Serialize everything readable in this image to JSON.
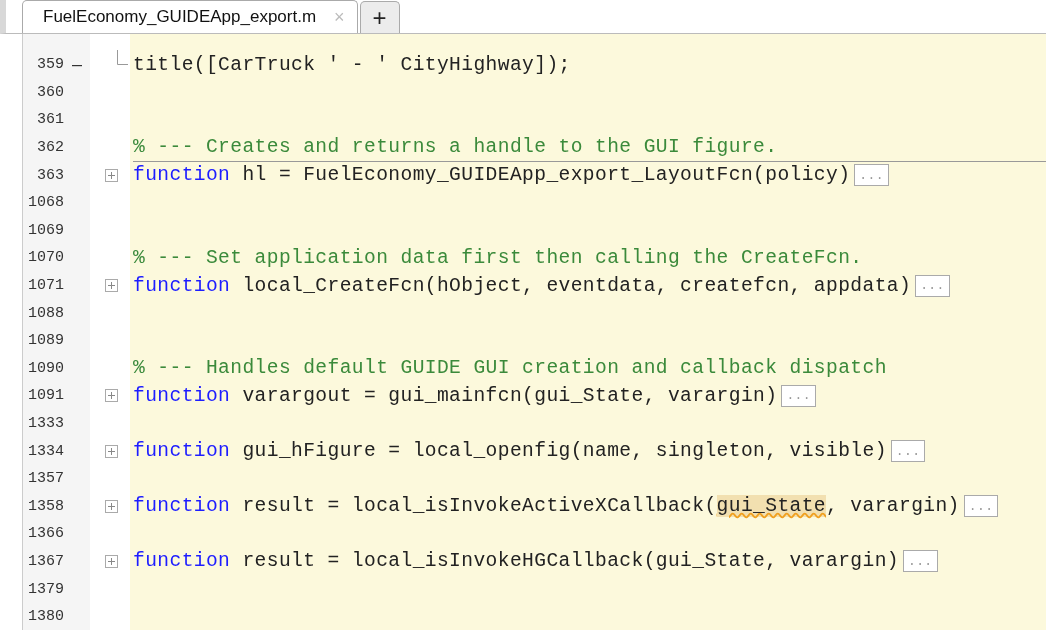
{
  "tabs": [
    {
      "label": "FuelEconomy_GUIDEApp_export.m",
      "selected": true,
      "close": "×"
    }
  ],
  "new_tab": "+",
  "lines": [
    {
      "number": "359",
      "kind": "code",
      "breakpoint_dash": "–",
      "fold_end": true,
      "segments": [
        {
          "text": "title([CarTruck ' - ' CityHighway]);",
          "kind": "plain"
        }
      ]
    },
    {
      "number": "360",
      "kind": "blank"
    },
    {
      "number": "361",
      "kind": "blank"
    },
    {
      "number": "362",
      "kind": "comment",
      "divider": true,
      "segments": [
        {
          "text": "% --- Creates and returns a handle to the GUI figure.",
          "kind": "comment"
        }
      ]
    },
    {
      "number": "363",
      "kind": "folded",
      "ellipsis": "...",
      "segments": [
        {
          "text": "function",
          "kind": "keyword"
        },
        {
          "text": " hl = FuelEconomy_GUIDEApp_export_LayoutFcn(policy)",
          "kind": "plain"
        }
      ]
    },
    {
      "number": "1068",
      "kind": "blank"
    },
    {
      "number": "1069",
      "kind": "blank"
    },
    {
      "number": "1070",
      "kind": "comment",
      "segments": [
        {
          "text": "% --- Set application data first then calling the CreateFcn.",
          "kind": "comment"
        }
      ]
    },
    {
      "number": "1071",
      "kind": "folded",
      "ellipsis": "...",
      "segments": [
        {
          "text": "function",
          "kind": "keyword"
        },
        {
          "text": " local_CreateFcn(hObject, eventdata, createfcn, appdata)",
          "kind": "plain"
        }
      ]
    },
    {
      "number": "1088",
      "kind": "blank"
    },
    {
      "number": "1089",
      "kind": "blank"
    },
    {
      "number": "1090",
      "kind": "comment",
      "segments": [
        {
          "text": "% --- Handles default GUIDE GUI creation and callback dispatch",
          "kind": "comment"
        }
      ]
    },
    {
      "number": "1091",
      "kind": "folded",
      "ellipsis": "...",
      "segments": [
        {
          "text": "function",
          "kind": "keyword"
        },
        {
          "text": " varargout = gui_mainfcn(gui_State, varargin)",
          "kind": "plain"
        }
      ]
    },
    {
      "number": "1333",
      "kind": "blank"
    },
    {
      "number": "1334",
      "kind": "folded",
      "ellipsis": "...",
      "segments": [
        {
          "text": "function",
          "kind": "keyword"
        },
        {
          "text": " gui_hFigure = local_openfig(name, singleton, visible)",
          "kind": "plain"
        }
      ]
    },
    {
      "number": "1357",
      "kind": "blank"
    },
    {
      "number": "1358",
      "kind": "folded",
      "ellipsis": "...",
      "segments": [
        {
          "text": "function",
          "kind": "keyword"
        },
        {
          "text": " result = local_isInvokeActiveXCallback(",
          "kind": "plain"
        },
        {
          "text": "gui_State",
          "kind": "warning"
        },
        {
          "text": ", varargin)",
          "kind": "plain"
        }
      ]
    },
    {
      "number": "1366",
      "kind": "blank"
    },
    {
      "number": "1367",
      "kind": "folded",
      "ellipsis": "...",
      "segments": [
        {
          "text": "function",
          "kind": "keyword"
        },
        {
          "text": " result = local_isInvokeHGCallback(gui_State, varargin)",
          "kind": "plain"
        }
      ]
    },
    {
      "number": "1379",
      "kind": "blank"
    },
    {
      "number": "1380",
      "kind": "blank"
    }
  ]
}
